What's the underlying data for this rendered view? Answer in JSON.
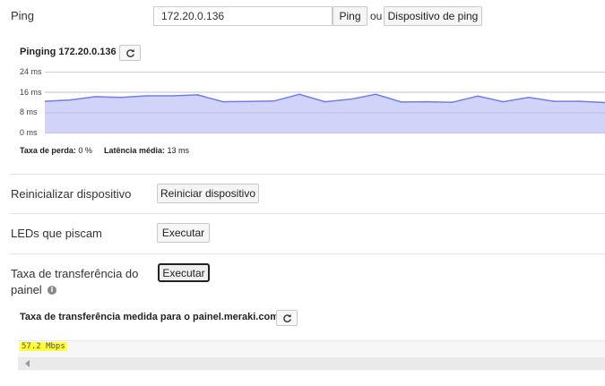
{
  "ping": {
    "label": "Ping",
    "host_value": "172.20.0.136",
    "ping_button": "Ping",
    "or_text": "ou",
    "ping_device_button": "Dispositivo de ping",
    "chart_title": "Pinging 172.20.0.136",
    "loss_label": "Taxa de perda:",
    "loss_value": "0 %",
    "latency_label": "Latência média:",
    "latency_value": "13 ms"
  },
  "reboot": {
    "label": "Reinicializar dispositivo",
    "button": "Reiniciar dispositivo"
  },
  "leds": {
    "label": "LEDs que piscam",
    "button": "Executar"
  },
  "throughput": {
    "label_line1": "Taxa de transferência do",
    "label_line2": "painel",
    "button": "Executar",
    "result_title": "Taxa de transferência medida para o painel.meraki.com",
    "result_value": "57.2 Mbps"
  },
  "colors": {
    "line": "#6f7fe8",
    "fill": "#c9ccf7",
    "highlight": "#ffff3b"
  },
  "chart_data": {
    "type": "area",
    "ylim": [
      0,
      24
    ],
    "yunit": "ms",
    "y_ticks": [
      "24 ms",
      "16 ms",
      "8 ms",
      "0 ms"
    ],
    "grid": true,
    "series": [
      {
        "values": [
          12.5,
          13,
          14.3,
          14,
          14.6,
          14.6,
          15,
          12.3,
          12.4,
          12.6,
          15.2,
          12.3,
          13.3,
          15.2,
          12.2,
          12.3,
          12.1,
          14.5,
          12.3,
          14,
          12.5,
          12.5,
          12
        ]
      }
    ]
  }
}
